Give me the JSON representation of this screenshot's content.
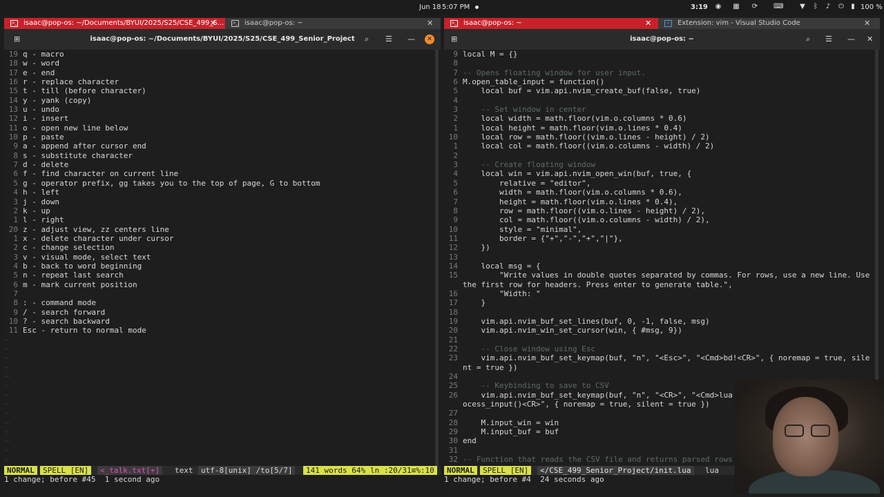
{
  "system_bar": {
    "date": "Jun 18",
    "time_center": "5:07 PM",
    "clock": "3:19",
    "battery": "100 %"
  },
  "left_window": {
    "tabs": [
      {
        "label": "isaac@pop-os: ~/Documents/BYUI/2025/S25/CSE_499_S...",
        "active": true
      },
      {
        "label": "isaac@pop-os: ~",
        "active": false
      }
    ],
    "title": "isaac@pop-os: ~/Documents/BYUI/2025/S25/CSE_499_Senior_Project",
    "lines": [
      {
        "n": "19",
        "t": "q - macro"
      },
      {
        "n": "18",
        "t": "w - word"
      },
      {
        "n": "17",
        "t": "e - end"
      },
      {
        "n": "16",
        "t": "r - replace character"
      },
      {
        "n": "15",
        "t": "t - till (before character)"
      },
      {
        "n": "14",
        "t": "y - yank (copy)"
      },
      {
        "n": "13",
        "t": "u - undo"
      },
      {
        "n": "12",
        "t": "i - insert"
      },
      {
        "n": "11",
        "t": "o - open new line below"
      },
      {
        "n": "10",
        "t": "p - paste"
      },
      {
        "n": "9",
        "t": "a - append after cursor end"
      },
      {
        "n": "8",
        "t": "s - substitute character"
      },
      {
        "n": "7",
        "t": "d - delete"
      },
      {
        "n": "6",
        "t": "f - find character on current line"
      },
      {
        "n": "5",
        "t": "g - operator prefix, gg takes you to the top of page, G to bottom"
      },
      {
        "n": "4",
        "t": "h - left"
      },
      {
        "n": "3",
        "t": "j - down"
      },
      {
        "n": "2",
        "t": "k - up"
      },
      {
        "n": "1",
        "t": "l - right"
      },
      {
        "n": "20",
        "t": "z - adjust view, zz centers line"
      },
      {
        "n": "1",
        "t": "x - delete character under cursor"
      },
      {
        "n": "2",
        "t": "c - change selection"
      },
      {
        "n": "3",
        "t": "v - visual mode, select text"
      },
      {
        "n": "4",
        "t": "b - back to word beginning"
      },
      {
        "n": "5",
        "t": "n - repeat last search"
      },
      {
        "n": "6",
        "t": "m - mark current position"
      },
      {
        "n": "7",
        "t": ""
      },
      {
        "n": "8",
        "t": ": - command mode"
      },
      {
        "n": "9",
        "t": "/ - search forward"
      },
      {
        "n": "10",
        "t": "? - search backward"
      },
      {
        "n": "11",
        "t": "Esc - return to normal mode"
      }
    ],
    "status": {
      "mode": "NORMAL",
      "spell": "SPELL [EN]",
      "file": "<_talk.txt[+]",
      "ft": "text",
      "enc": "utf-8[unix] /to[5/7]",
      "words": "141 words 64%",
      "pos": "ln :20/31≡%:10"
    },
    "message": "1 change; before #45  1 second ago"
  },
  "right_window": {
    "tabs": [
      {
        "label": "isaac@pop-os: ~",
        "active": true
      },
      {
        "label": "Extension: vim - Visual Studio Code",
        "active": false
      }
    ],
    "title": "isaac@pop-os: ~",
    "lines": [
      {
        "n": "9",
        "t": "local M = {}"
      },
      {
        "n": "8",
        "t": ""
      },
      {
        "n": "7",
        "t": "-- Opens floating window for user input."
      },
      {
        "n": "6",
        "t": "M.open_table_input = function()"
      },
      {
        "n": "5",
        "t": "    local buf = vim.api.nvim_create_buf(false, true)"
      },
      {
        "n": "4",
        "t": ""
      },
      {
        "n": "3",
        "t": "    -- Set window in center"
      },
      {
        "n": "2",
        "t": "    local width = math.floor(vim.o.columns * 0.6)"
      },
      {
        "n": "1",
        "t": "    local height = math.floor(vim.o.lines * 0.4)"
      },
      {
        "n": "10",
        "t": "    local row = math.floor((vim.o.lines - height) / 2)"
      },
      {
        "n": "1",
        "t": "    local col = math.floor((vim.o.columns - width) / 2)"
      },
      {
        "n": "2",
        "t": ""
      },
      {
        "n": "3",
        "t": "    -- Create floating window"
      },
      {
        "n": "4",
        "t": "    local win = vim.api.nvim_open_win(buf, true, {"
      },
      {
        "n": "5",
        "t": "        relative = \"editor\","
      },
      {
        "n": "6",
        "t": "        width = math.floor(vim.o.columns * 0.6),"
      },
      {
        "n": "7",
        "t": "        height = math.floor(vim.o.lines * 0.4),"
      },
      {
        "n": "8",
        "t": "        row = math.floor((vim.o.lines - height) / 2),"
      },
      {
        "n": "9",
        "t": "        col = math.floor((vim.o.columns - width) / 2),"
      },
      {
        "n": "10",
        "t": "        style = \"minimal\","
      },
      {
        "n": "11",
        "t": "        border = {\"+\",\"-\",\"+\",\"|\"},"
      },
      {
        "n": "12",
        "t": "    })"
      },
      {
        "n": "13",
        "t": ""
      },
      {
        "n": "14",
        "t": "    local msg = {"
      },
      {
        "n": "15",
        "t": "        \"Write values in double quotes separated by commas. For rows, use a new line. Use"
      },
      {
        "n": "",
        "t": "the first row for headers. Press enter to generate table.\","
      },
      {
        "n": "16",
        "t": "        \"Width: \""
      },
      {
        "n": "17",
        "t": "    }"
      },
      {
        "n": "18",
        "t": ""
      },
      {
        "n": "19",
        "t": "    vim.api.nvim_buf_set_lines(buf, 0, -1, false, msg)"
      },
      {
        "n": "20",
        "t": "    vim.api.nvim_win_set_cursor(win, { #msg, 9})"
      },
      {
        "n": "21",
        "t": ""
      },
      {
        "n": "22",
        "t": "    -- Close window using Esc"
      },
      {
        "n": "23",
        "t": "    vim.api.nvim_buf_set_keymap(buf, \"n\", \"<Esc>\", \"<Cmd>bd!<CR>\", { noremap = true, sile"
      },
      {
        "n": "",
        "t": "nt = true })"
      },
      {
        "n": "24",
        "t": ""
      },
      {
        "n": "25",
        "t": "    -- Keybinding to save to CSV"
      },
      {
        "n": "26",
        "t": "    vim.api.nvim_buf_set_keymap(buf, \"n\", \"<CR>\", \"<Cmd>lua"
      },
      {
        "n": "",
        "t": "ocess_input()<CR>\", { noremap = true, silent = true })"
      },
      {
        "n": "27",
        "t": ""
      },
      {
        "n": "28",
        "t": "    M.input_win = win"
      },
      {
        "n": "29",
        "t": "    M.input_buf = buf"
      },
      {
        "n": "30",
        "t": "end"
      },
      {
        "n": "31",
        "t": ""
      },
      {
        "n": "32",
        "t": "-- Function that reads the CSV file and returns parsed rows"
      }
    ],
    "status": {
      "mode": "NORMAL",
      "spell": "SPELL [EN]",
      "file": "</CSE_499_Senior_Project/init.lua",
      "ft": "lua"
    },
    "message": "1 change; before #4  24 seconds ago"
  },
  "colors": {
    "tab_active": "#c8212a",
    "mode_bg": "#d8e04a",
    "highlight": "#c0504d",
    "filename_modified": "#e24cc0"
  }
}
